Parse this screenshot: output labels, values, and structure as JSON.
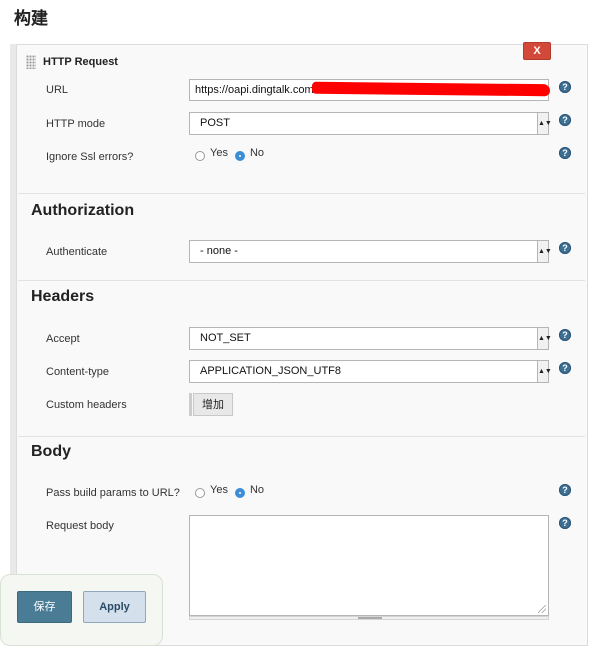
{
  "page": {
    "heading": "构建"
  },
  "step": {
    "title": "HTTP Request",
    "delete_label": "X"
  },
  "fields": {
    "url": {
      "label": "URL",
      "value": "https://oapi.dingtalk.com"
    },
    "http_mode": {
      "label": "HTTP mode",
      "value": "POST"
    },
    "ignore_ssl": {
      "label": "Ignore Ssl errors?",
      "yes": "Yes",
      "no": "No",
      "selected": "No"
    }
  },
  "authorization": {
    "title": "Authorization",
    "authenticate": {
      "label": "Authenticate",
      "value": "- none -"
    }
  },
  "headers": {
    "title": "Headers",
    "accept": {
      "label": "Accept",
      "value": "NOT_SET"
    },
    "content_type": {
      "label": "Content-type",
      "value": "APPLICATION_JSON_UTF8"
    },
    "custom": {
      "label": "Custom headers",
      "add_label": "增加"
    }
  },
  "body": {
    "title": "Body",
    "pass_params": {
      "label": "Pass build params to URL?",
      "yes": "Yes",
      "no": "No",
      "selected": "No"
    },
    "request_body": {
      "label": "Request body",
      "value": ""
    }
  },
  "footer": {
    "save_label": "保存",
    "apply_label": "Apply"
  },
  "icons": {
    "help": "help-icon",
    "select_arrow": "▲▼"
  },
  "colors": {
    "save": "#4a7c95",
    "delete": "#d24939",
    "help": "#3d6f93",
    "radio_checked": "#3b8dd6"
  }
}
